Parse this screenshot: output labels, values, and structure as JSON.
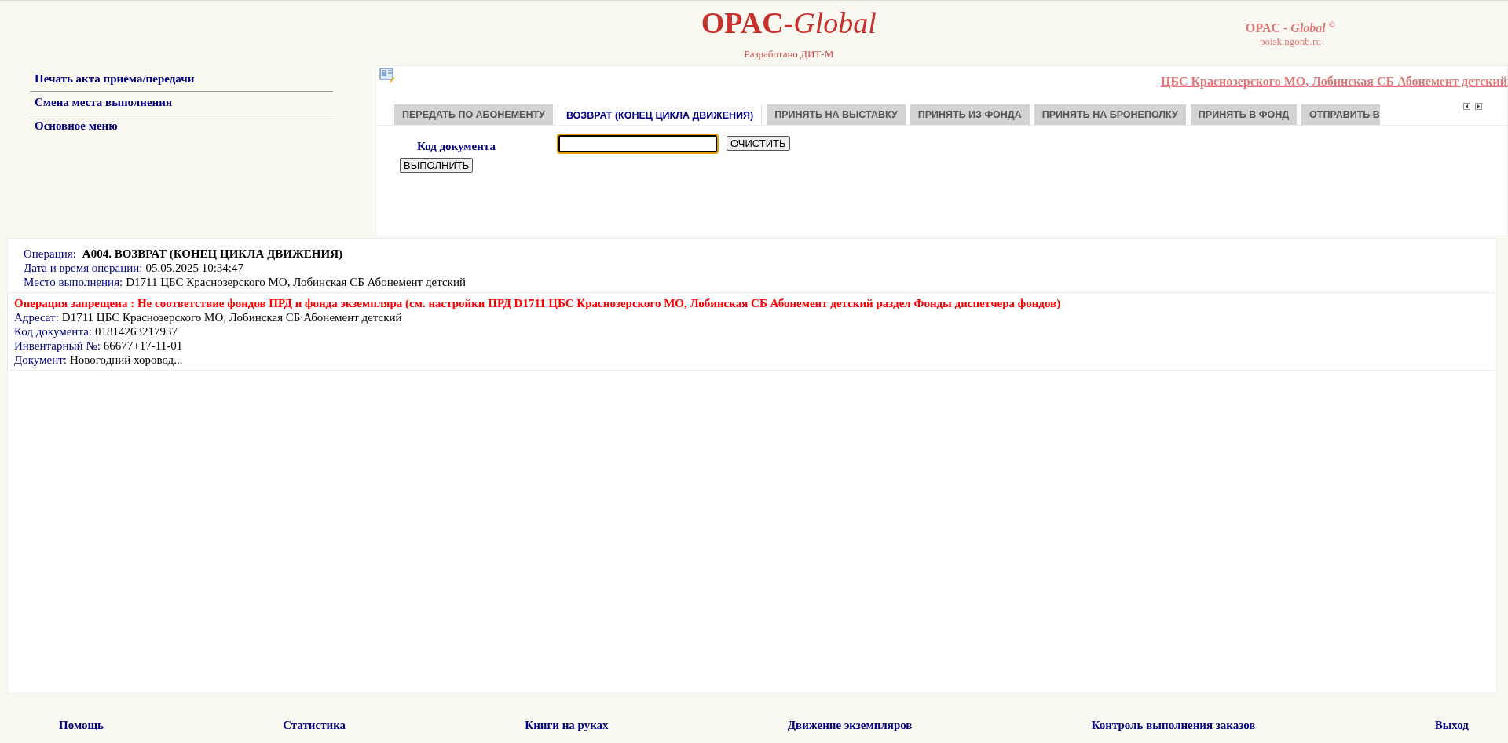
{
  "header": {
    "logo_main": "OPAC-",
    "logo_italic": "Global",
    "developer": "Разработано ДИТ-М",
    "brand_main": "OPAC - ",
    "brand_italic": "Global",
    "brand_mark": "©",
    "site": "poisk.ngonb.ru"
  },
  "sidebar": {
    "items": [
      {
        "label": "Печать акта приема/передачи"
      },
      {
        "label": "Смена места выполнения"
      },
      {
        "label": "Основное меню"
      }
    ]
  },
  "panel": {
    "location_link": "ЦБС Краснозерского МО, Лобинская СБ Абонемент детский",
    "tabs": [
      {
        "label": "ПЕРЕДАТЬ ПО АБОНЕМЕНТУ",
        "selected": false
      },
      {
        "label": "ВОЗВРАТ (КОНЕЦ ЦИКЛА ДВИЖЕНИЯ)",
        "selected": true
      },
      {
        "label": "ПРИНЯТЬ НА ВЫСТАВКУ",
        "selected": false
      },
      {
        "label": "ПРИНЯТЬ ИЗ ФОНДА",
        "selected": false
      },
      {
        "label": "ПРИНЯТЬ НА БРОНЕПОЛКУ",
        "selected": false
      },
      {
        "label": "ПРИНЯТЬ В ФОНД",
        "selected": false
      },
      {
        "label": "ОТПРАВИТЬ В",
        "selected": false
      }
    ],
    "field_label": "Код документа",
    "clear_button": "ОЧИСТИТЬ",
    "execute_button": "ВЫПОЛНИТЬ"
  },
  "operation": {
    "label": "Операция:",
    "value": "А004. ВОЗВРАТ (КОНЕЦ ЦИКЛА ДВИЖЕНИЯ)",
    "details": [
      {
        "label": "Дата и время операции:",
        "value": "05.05.2025 10:34:47"
      },
      {
        "label": "Место выполнения:",
        "value": "D1711 ЦБС Краснозерского МО, Лобинская СБ Абонемент детский"
      }
    ]
  },
  "result": {
    "error": "Операция запрещена : Не соответствие фондов ПРД и фонда экземпляра (см. настройки ПРД D1711 ЦБС Краснозерского МО, Лобинская СБ Абонемент детский раздел Фонды диспетчера фондов)",
    "details": [
      {
        "label": "Адресат:",
        "value": "D1711 ЦБС Краснозерского МО, Лобинская СБ Абонемент детский"
      },
      {
        "label": "Код документа:",
        "value": "01814263217937"
      },
      {
        "label": "Инвентарный №:",
        "value": "66677+17-11-01"
      },
      {
        "label": "Документ:",
        "value": "Новогодний хоровод..."
      }
    ]
  },
  "footer": {
    "links": [
      "Помощь",
      "Статистика",
      "Книги на руках",
      "Движение экземпляров",
      "Контроль выполнения заказов",
      "Выход"
    ]
  }
}
